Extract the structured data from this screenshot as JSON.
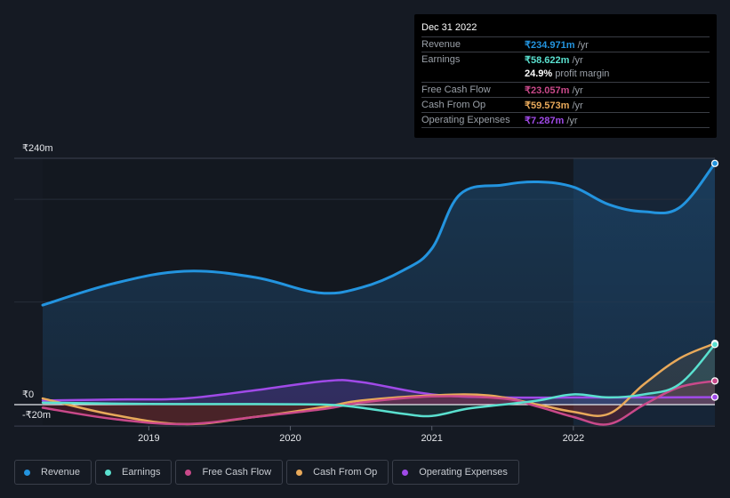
{
  "tooltip": {
    "date": "Dec 31 2022",
    "rows": [
      {
        "label": "Revenue",
        "value": "₹234.971m",
        "unit": "/yr",
        "color": "#2394df"
      },
      {
        "label": "Earnings",
        "value": "₹58.622m",
        "unit": "/yr",
        "color": "#5ae0cf"
      },
      {
        "label": "",
        "value": "24.9%",
        "unit": "profit margin",
        "color": "#ffffff"
      },
      {
        "label": "Free Cash Flow",
        "value": "₹23.057m",
        "unit": "/yr",
        "color": "#c9498a"
      },
      {
        "label": "Cash From Op",
        "value": "₹59.573m",
        "unit": "/yr",
        "color": "#e8a95a"
      },
      {
        "label": "Operating Expenses",
        "value": "₹7.287m",
        "unit": "/yr",
        "color": "#a04ae8"
      }
    ]
  },
  "legend": [
    {
      "label": "Revenue",
      "color": "#2394df"
    },
    {
      "label": "Earnings",
      "color": "#5ae0cf"
    },
    {
      "label": "Free Cash Flow",
      "color": "#c9498a"
    },
    {
      "label": "Cash From Op",
      "color": "#e8a95a"
    },
    {
      "label": "Operating Expenses",
      "color": "#a04ae8"
    }
  ],
  "chart_data": {
    "type": "area",
    "title": "",
    "xlabel": "",
    "ylabel": "",
    "y_tick_labels": [
      "₹240m",
      "₹0",
      "-₹20m"
    ],
    "x_tick_labels": [
      "2019",
      "2020",
      "2021",
      "2022"
    ],
    "ylim": [
      -20,
      240
    ],
    "xlim": [
      2018.25,
      2023.0
    ],
    "highlight_from": 2022.0,
    "grid": true,
    "legend_position": "bottom",
    "series": [
      {
        "name": "Revenue",
        "color": "#2394df",
        "x": [
          2018.25,
          2018.75,
          2019.25,
          2019.75,
          2020.2,
          2020.5,
          2020.8,
          2021.0,
          2021.2,
          2021.5,
          2021.75,
          2022.0,
          2022.25,
          2022.5,
          2022.75,
          2023.0
        ],
        "values": [
          97,
          118,
          130,
          124,
          109,
          114,
          131,
          152,
          205,
          214,
          217,
          212,
          195,
          188,
          192,
          235
        ]
      },
      {
        "name": "Earnings",
        "color": "#5ae0cf",
        "x": [
          2018.25,
          2018.75,
          2019.25,
          2019.75,
          2020.25,
          2020.5,
          2020.8,
          2021.0,
          2021.25,
          2021.5,
          2021.75,
          2022.0,
          2022.25,
          2022.5,
          2022.75,
          2023.0
        ],
        "values": [
          2,
          1,
          0.5,
          0.5,
          0,
          -3,
          -9,
          -11,
          -4,
          0,
          4,
          10,
          7,
          10,
          20,
          58.6
        ]
      },
      {
        "name": "Free Cash Flow",
        "color": "#c9498a",
        "x": [
          2018.25,
          2018.75,
          2019.25,
          2019.75,
          2020.25,
          2020.5,
          2021.0,
          2021.5,
          2021.75,
          2022.0,
          2022.25,
          2022.5,
          2022.75,
          2023.0
        ],
        "values": [
          -3,
          -14,
          -19,
          -12,
          -4,
          2,
          8,
          6,
          -2,
          -12,
          -19,
          0,
          17,
          23.1
        ]
      },
      {
        "name": "Cash From Op",
        "color": "#e8a95a",
        "x": [
          2018.25,
          2018.75,
          2019.25,
          2019.75,
          2020.25,
          2020.5,
          2021.0,
          2021.4,
          2021.75,
          2022.0,
          2022.25,
          2022.5,
          2022.75,
          2023.0
        ],
        "values": [
          6,
          -10,
          -19,
          -12,
          -2,
          4,
          9,
          9,
          0,
          -7,
          -9,
          20,
          45,
          59.6
        ]
      },
      {
        "name": "Operating Expenses",
        "color": "#a04ae8",
        "x": [
          2018.25,
          2018.75,
          2019.25,
          2019.75,
          2020.25,
          2020.5,
          2021.0,
          2021.5,
          2022.0,
          2022.5,
          2023.0
        ],
        "values": [
          4,
          5,
          6,
          14,
          23,
          22,
          10,
          7,
          7,
          7,
          7.3
        ]
      }
    ]
  }
}
